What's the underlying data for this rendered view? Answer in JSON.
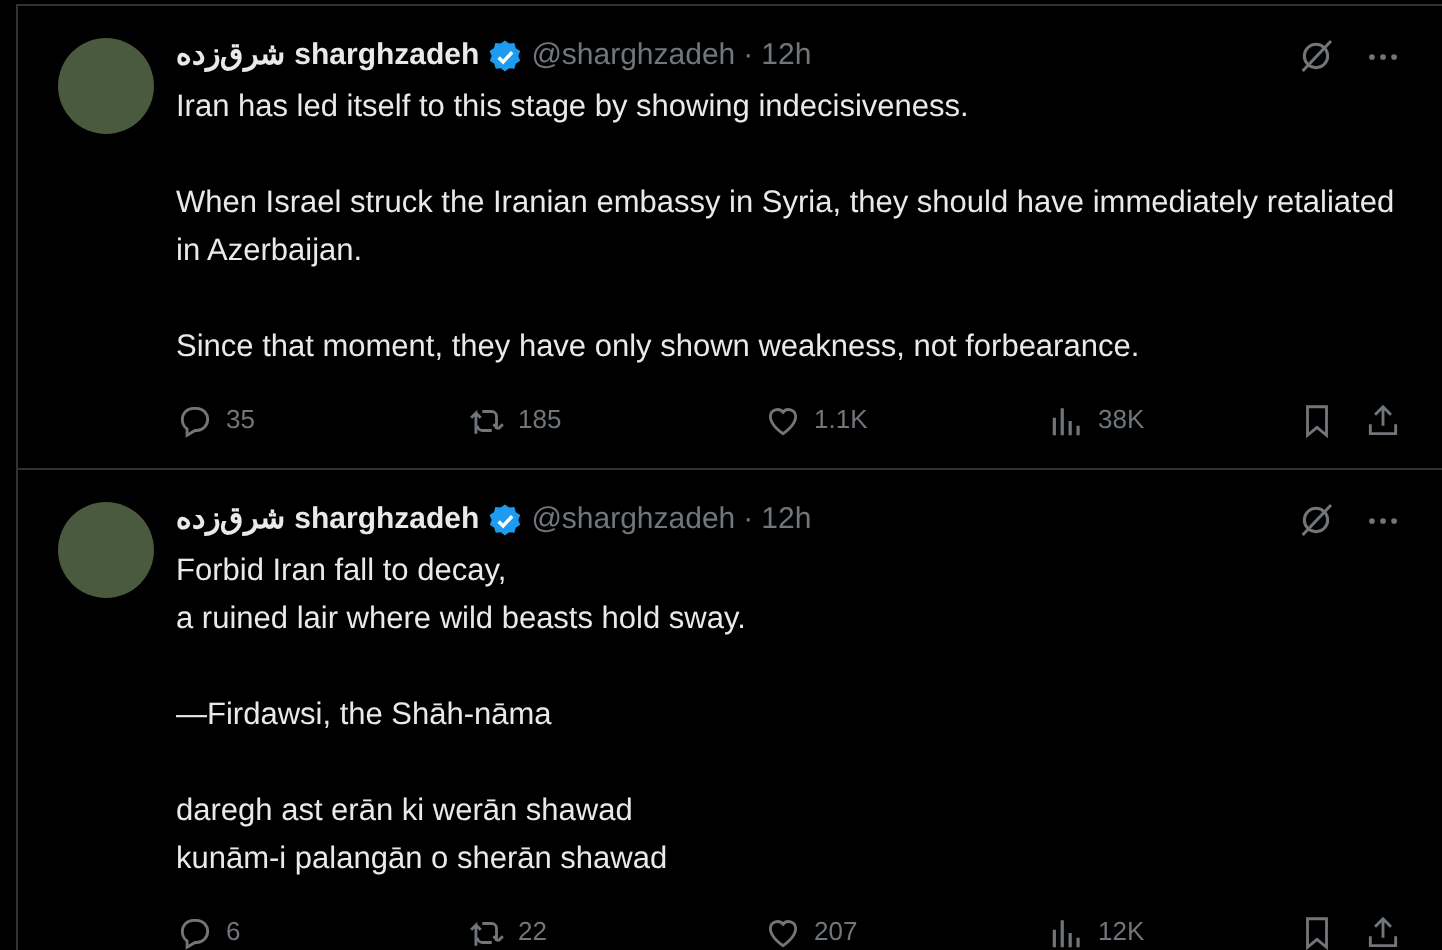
{
  "tweets": [
    {
      "display_name": "شرق‌زده sharghzadeh",
      "verified": true,
      "handle": "@sharghzadeh",
      "separator": "·",
      "time": "12h",
      "paragraphs": [
        [
          "Iran has led itself to this stage by showing indecisiveness."
        ],
        [
          "When Israel struck the Iranian embassy in Syria, they should have immediately retaliated in Azerbaijan."
        ],
        [
          "Since that moment, they have only shown weakness, not forbearance."
        ]
      ],
      "replies": "35",
      "reposts": "185",
      "likes": "1.1K",
      "views": "38K"
    },
    {
      "display_name": "شرق‌زده sharghzadeh",
      "verified": true,
      "handle": "@sharghzadeh",
      "separator": "·",
      "time": "12h",
      "paragraphs": [
        [
          "Forbid Iran fall to decay,",
          "a ruined lair where wild beasts hold sway."
        ],
        [
          "—Firdawsi, the Shāh-nāma"
        ],
        [
          "daregh ast erān ki werān shawad",
          "kunām-i palangān o sherān shawad"
        ]
      ],
      "replies": "6",
      "reposts": "22",
      "likes": "207",
      "views": "12K"
    }
  ]
}
